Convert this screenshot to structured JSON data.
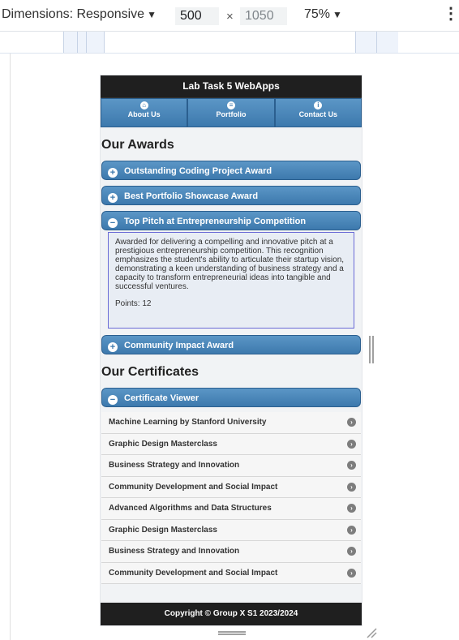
{
  "devtools": {
    "dimensions_label": "Dimensions: Responsive",
    "width_value": "500",
    "height_value": "1050",
    "times_sign": "×",
    "zoom": "75%",
    "dropdown_glyph": "▼",
    "more_glyph": "⋮"
  },
  "app": {
    "title": "Lab Task 5 WebApps",
    "nav": [
      {
        "label": "About Us",
        "icon": "home-icon"
      },
      {
        "label": "Portfolio",
        "icon": "grid-icon"
      },
      {
        "label": "Contact Us",
        "icon": "info-icon"
      }
    ],
    "awards_heading": "Our Awards",
    "awards": [
      {
        "title": "Outstanding Coding Project Award",
        "expanded": false
      },
      {
        "title": "Best Portfolio Showcase Award",
        "expanded": false
      },
      {
        "title": "Top Pitch at Entrepreneurship Competition",
        "expanded": true
      },
      {
        "title": "Community Impact Award",
        "expanded": false
      }
    ],
    "expanded_award": {
      "description": "Awarded for delivering a compelling and innovative pitch at a prestigious entrepreneurship competition. This recognition emphasizes the student's ability to articulate their startup vision, demonstrating a keen understanding of business strategy and a capacity to transform entrepreneurial ideas into tangible and successful ventures.",
      "points": "Points: 12"
    },
    "certificates_heading": "Our Certificates",
    "certificate_viewer": "Certificate Viewer",
    "certificates": [
      "Machine Learning by Stanford University",
      "Graphic Design Masterclass",
      "Business Strategy and Innovation",
      "Community Development and Social Impact",
      "Advanced Algorithms and Data Structures",
      "Graphic Design Masterclass",
      "Business Strategy and Innovation",
      "Community Development and Social Impact"
    ],
    "footer": "Copyright © Group X S1 2023/2024"
  },
  "colors": {
    "accent_blue": "#3d79ad",
    "header_dark": "#1f1f1f",
    "panel_border": "#6b6bd6"
  }
}
